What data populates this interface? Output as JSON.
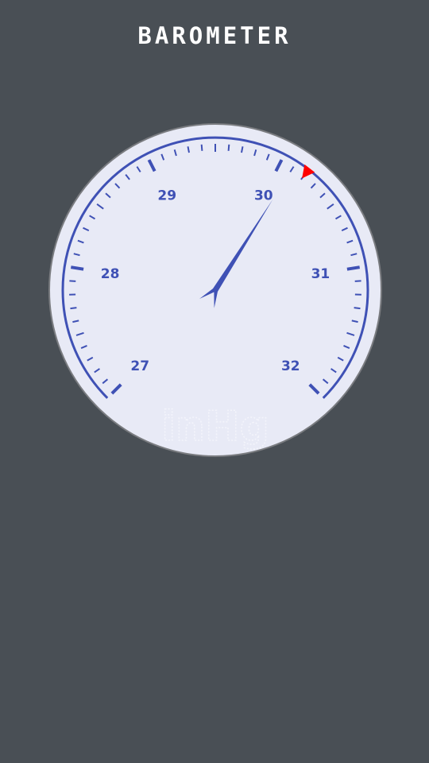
{
  "app": {
    "title": "BAROMETER"
  },
  "gauge": {
    "min": 27,
    "max": 32,
    "labels": [
      "27",
      "28",
      "29",
      "30",
      "31",
      "32"
    ],
    "minor_ticks_per_major": 10,
    "needle_value": 30.1,
    "marker_value": 30.2,
    "unit": "inHg",
    "colors": {
      "face": "#e8eaf6",
      "rim": "#7a7c80",
      "scale": "#3f51b5",
      "marker": "#ff0000",
      "unit": "#f3f4fb"
    }
  }
}
